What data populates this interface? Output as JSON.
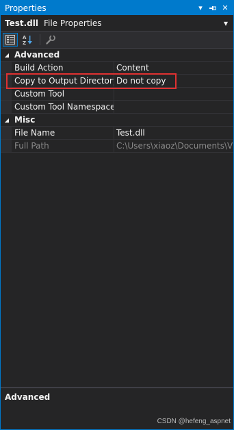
{
  "window": {
    "title": "Properties",
    "dropdown_glyph": "▾",
    "pin_glyph": "⊣",
    "close_glyph": "✕"
  },
  "object_bar": {
    "name": "Test.dll",
    "type": "File Properties",
    "arrow_glyph": "▾"
  },
  "toolbar": {
    "buttons": [
      {
        "icon": "categorized-icon",
        "active": true
      },
      {
        "icon": "alphabetical-sort-icon",
        "active": false
      },
      {
        "icon": "property-pages-wrench-icon",
        "active": false
      }
    ]
  },
  "grid": {
    "categories": [
      {
        "label": "Advanced",
        "expander": "◢",
        "properties": [
          {
            "name": "Build Action",
            "value": "Content"
          },
          {
            "name": "Copy to Output Directory",
            "value": "Do not copy"
          },
          {
            "name": "Custom Tool",
            "value": ""
          },
          {
            "name": "Custom Tool Namespace",
            "value": ""
          }
        ]
      },
      {
        "label": "Misc",
        "expander": "◢",
        "properties": [
          {
            "name": "File Name",
            "value": "Test.dll"
          },
          {
            "name": "Full Path",
            "value": "C:\\Users\\xiaoz\\Documents\\Visua"
          }
        ]
      }
    ]
  },
  "description": {
    "title": "Advanced"
  },
  "watermark": "CSDN @hefeng_aspnet",
  "colors": {
    "accent": "#007acc",
    "highlight": "#e03131",
    "background": "#252526"
  }
}
